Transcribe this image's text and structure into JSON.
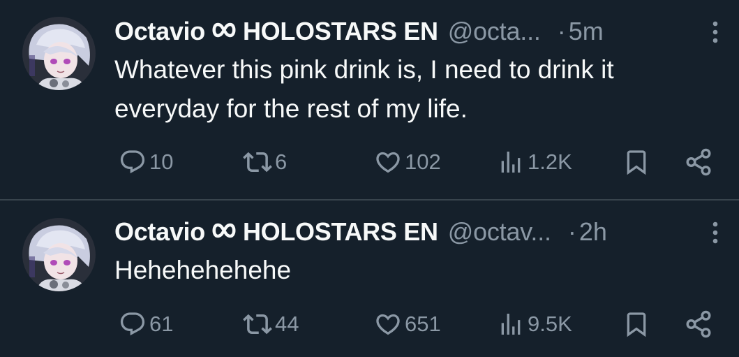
{
  "colors": {
    "background": "#15202b",
    "primary_text": "#f7f9f9",
    "secondary_text": "#8b98a5",
    "divider": "#38444d"
  },
  "tweets": [
    {
      "display_name": "Octavio",
      "affiliation": "HOLOSTARS EN",
      "handle": "@octa...",
      "separator": "·",
      "time": "5m",
      "text": "Whatever this pink drink is, I need to drink it everyday for the rest of my life.",
      "replies": "10",
      "retweets": "6",
      "likes": "102",
      "views": "1.2K",
      "icons": [
        "reply-icon",
        "retweet-icon",
        "like-icon",
        "views-icon",
        "bookmark-icon",
        "share-icon",
        "more-icon"
      ]
    },
    {
      "display_name": "Octavio",
      "affiliation": "HOLOSTARS EN",
      "handle": "@octav...",
      "separator": "·",
      "time": "2h",
      "text": "Hehehehehehe",
      "replies": "61",
      "retweets": "44",
      "likes": "651",
      "views": "9.5K",
      "icons": [
        "reply-icon",
        "retweet-icon",
        "like-icon",
        "views-icon",
        "bookmark-icon",
        "share-icon",
        "more-icon"
      ]
    }
  ]
}
